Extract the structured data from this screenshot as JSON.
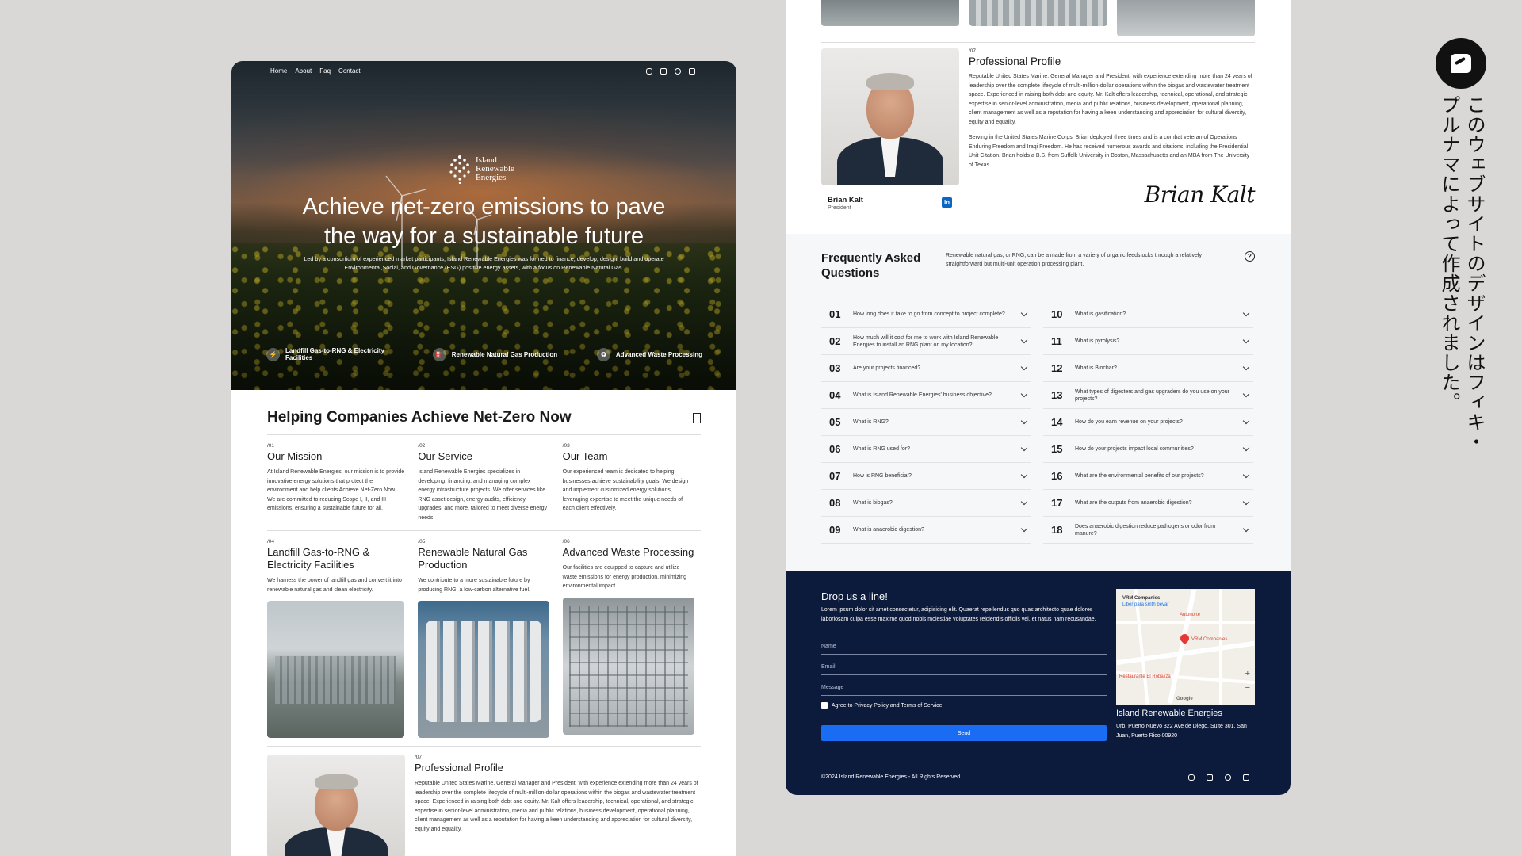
{
  "left": {
    "nav": [
      "Home",
      "About",
      "Faq",
      "Contact"
    ],
    "social_icons": [
      "instagram-icon",
      "facebook-icon",
      "twitter-icon",
      "linkedin-icon"
    ],
    "logo": {
      "line1": "Island",
      "line2": "Renewable",
      "line3": "Energies"
    },
    "hero_title_1": "Achieve net-zero emissions to pave",
    "hero_title_2": "the way for a sustainable future",
    "hero_sub": "Led by a consortium of experienced market participants, Island Renewable Energies was formed to finance, develop, design, build and operate Environmental,Social, and Governance (ESG) positive energy assets, with a focus on Renewable Natural Gas.",
    "features": [
      {
        "label": "Landfill Gas-to-RNG & Electricity Facilities",
        "icon": "bolt-icon"
      },
      {
        "label": "Renewable Natural Gas Production",
        "icon": "fuel-icon"
      },
      {
        "label": "Advanced Waste Processing",
        "icon": "recycle-icon"
      }
    ],
    "section_title": "Helping Companies Achieve Net-Zero Now",
    "cards": [
      {
        "num": "/01",
        "title": "Our Mission",
        "text": "At Island Renewable Energies, our mission is to provide innovative energy solutions that protect the environment and help clients Achieve Net-Zero Now. We are committed to reducing Scope I, II, and III emissions, ensuring a sustainable future for all."
      },
      {
        "num": "/02",
        "title": "Our Service",
        "text": "Island Renewable Energies specializes in developing, financing, and managing complex energy infrastructure projects. We offer services like RNG asset design, energy audits, efficiency upgrades, and more, tailored to meet diverse energy needs."
      },
      {
        "num": "/03",
        "title": "Our Team",
        "text": "Our experienced team is dedicated to helping businesses achieve sustainability goals. We design and implement customized energy solutions, leveraging expertise to meet the unique needs of each client effectively."
      },
      {
        "num": "/04",
        "title": "Landfill Gas-to-RNG & Electricity Facilities",
        "text": "We harness the power of landfill gas and convert it into renewable natural gas and clean electricity."
      },
      {
        "num": "/05",
        "title": "Renewable Natural Gas Production",
        "text": "We contribute to a more sustainable future by producing RNG, a low-carbon alternative fuel."
      },
      {
        "num": "/06",
        "title": "Advanced Waste Processing",
        "text": "Our facilities are equipped to capture and utilize waste emissions for energy production, minimizing environmental impact."
      }
    ],
    "profile": {
      "num": "/07",
      "title": "Professional Profile",
      "text": "Reputable United States Marine, General Manager and President, with experience extending more than 24 years of leadership over the complete lifecycle of multi-million-dollar operations within the biogas and wastewater treatment space. Experienced in raising both debt and equity. Mr. Kalt offers leadership, technical, operational, and strategic expertise in senior-level administration, media and public relations, business development, operational planning, client management as well as a reputation for having a keen understanding and appreciation for cultural diversity, equity and equality."
    }
  },
  "right": {
    "profile": {
      "num": "/07",
      "title": "Professional Profile",
      "p1": "Reputable United States Marine, General Manager and President, with experience extending more than 24 years of leadership over the complete lifecycle of multi-million-dollar operations within the biogas and wastewater treatment space. Experienced in raising both debt and equity. Mr. Kalt offers leadership, technical, operational, and strategic expertise in senior-level administration, media and public relations, business development, operational planning, client management as well as a reputation for having a keen understanding and appreciation for cultural diversity, equity and equality.",
      "p2": "Serving in the United States Marine Corps, Brian deployed three times and is a combat veteran of Operations Enduring Freedom and Iraqi Freedom. He has received numerous awards and citations, including the Presidential Unit Citation. Brian holds a B.S. from Suffolk University in Boston, Massachusetts and an MBA from The University of Texas.",
      "name": "Brian Kalt",
      "role": "President",
      "linkedin": "in",
      "signature": "Brian Kalt"
    },
    "faq": {
      "title": "Frequently Asked Questions",
      "desc": "Renewable natural gas, or RNG, can be a made from a variety of organic feedstocks through a relatively straightforward but multi-unit operation processing plant.",
      "help_glyph": "?",
      "col1": [
        {
          "n": "01",
          "q": "How long does it take to go from concept to project complete?"
        },
        {
          "n": "02",
          "q": "How much will it cost for me to work with Island Renewable Energies to install an RNG plant on my location?"
        },
        {
          "n": "03",
          "q": "Are your projects financed?"
        },
        {
          "n": "04",
          "q": "What is Island Renewable Energies' business objective?"
        },
        {
          "n": "05",
          "q": "What is RNG?"
        },
        {
          "n": "06",
          "q": "What is RNG used for?"
        },
        {
          "n": "07",
          "q": "How is RNG beneficial?"
        },
        {
          "n": "08",
          "q": "What is biogas?"
        },
        {
          "n": "09",
          "q": "What is anaerobic digestion?"
        }
      ],
      "col2": [
        {
          "n": "10",
          "q": "What is gasification?"
        },
        {
          "n": "11",
          "q": "What is pyrolysis?"
        },
        {
          "n": "12",
          "q": "What is Biochar?"
        },
        {
          "n": "13",
          "q": "What types of digesters and gas upgraders do you use on your projects?"
        },
        {
          "n": "14",
          "q": "How do you earn revenue on your projects?"
        },
        {
          "n": "15",
          "q": "How do your projects impact local communities?"
        },
        {
          "n": "16",
          "q": "What are the environmental benefits of our projects?"
        },
        {
          "n": "17",
          "q": "What are the outputs from anaerobic digestion?"
        },
        {
          "n": "18",
          "q": "Does anaerobic digestion reduce pathogens or odor from manure?"
        }
      ]
    },
    "contact": {
      "title": "Drop us a line!",
      "desc": "Lorem ipsum dolor sit amet consectetur, adipisicing elit. Quaerat repellendus quo quas architecto quae dolores laboriosam culpa esse maxime quod nobis molestiae voluptates reiciendis officiis vel, et natus nam recusandae.",
      "name_label": "Name",
      "email_label": "Email",
      "message_label": "Message",
      "agree": "Agree to Privacy Policy and Terms of Service",
      "send": "Send",
      "company": "Island Renewable Energies",
      "address": "Urb. Puerto Nuevo 322 Ave de Diego, Suite 301, San Juan, Puerto Rico 00920",
      "copyright": "©2024 Island Renewable Energies - All Rights Reserved",
      "map": {
        "place": "VRM Companies",
        "place_sub": "Liber para smth bevar",
        "pin_label": "VRM Companies",
        "poi1": "Autonorte",
        "poi2": "Restaurante El Robaliza",
        "zoom_in": "+",
        "zoom_out": "−",
        "google": "Google"
      }
    }
  },
  "side": {
    "brand_icon": "studio-logo-icon",
    "vertical_text": "このウェブサイトのデザインはフィキ・プルナマによって作成されました。"
  },
  "colors": {
    "navy": "#0c1a3b",
    "blue": "#1a6df3",
    "background": "#d9d8d6"
  }
}
